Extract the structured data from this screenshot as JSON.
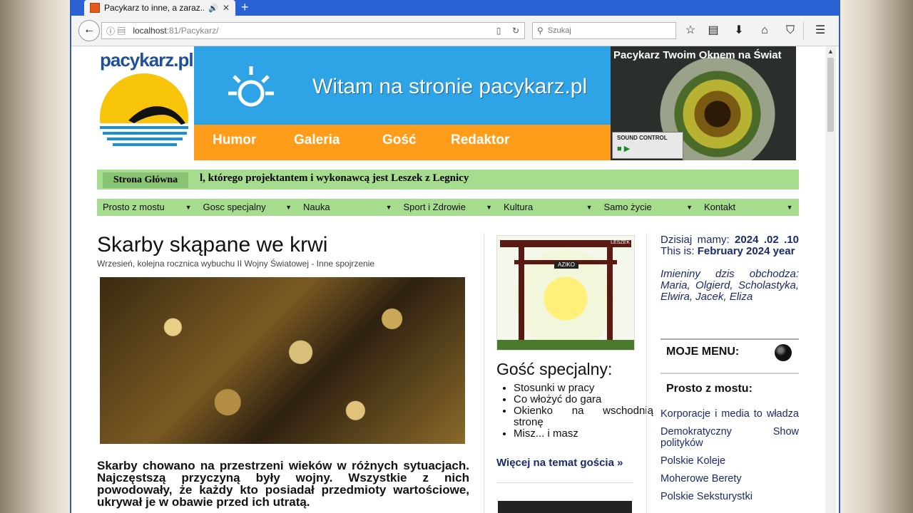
{
  "browser": {
    "tab_title": "Pacykarz to inne, a zaraz...",
    "url_prefix": "localhost",
    "url_rest": ":81/Pacykarz/",
    "search_placeholder": "Szukaj"
  },
  "site": {
    "logo": "pacykarz.pl",
    "banner_title": "Witam na stronie pacykarz.pl",
    "banner_nav": [
      "Humor",
      "Galeria",
      "Gość",
      "Redaktor"
    ],
    "eye_title": "Pacykarz Twoim Oknem na Świat",
    "sound_control": "SOUND CONTROL",
    "home_label": "Strona Główna",
    "ticker": "l, którego projektantem i wykonawcą jest Leszek z Legnicy",
    "menu": [
      "Prosto z mostu",
      "Gosc specjalny",
      "Nauka",
      "Sport i Zdrowie",
      "Kultura",
      "Samo życie",
      "Kontakt"
    ]
  },
  "article": {
    "title": "Skarby skąpane we krwi",
    "subtitle": "Wrzesień, kolejna rocznica wybuchu II Wojny Światowej - Inne spojrzenie",
    "body": "Skarby chowano na przestrzeni wieków w różnych sytuacjach. Najczęstszą przyczyną były wojny. Wszystkie z nich powodowały, że każdy kto posiadał przedmioty wartościowe, ukrywał je w obawie przed ich utratą."
  },
  "guest": {
    "image_sign": "AZIKO",
    "image_corner": "LESZEK",
    "title": "Gość specjalny:",
    "items": [
      "Stosunki w pracy",
      "Co włożyć do gara",
      "Okienko na wschodnią stronę",
      "Misz... i masz"
    ],
    "more": "Więcej na temat gościa »"
  },
  "sidebar": {
    "date_prefix": "Dzisiaj mamy:",
    "date_value": "2024 .02 .10",
    "this_is": "This is:",
    "this_value": "February 2024 year",
    "names": "Imieniny dzis obchodza: Maria, Olgierd, Scholastyka, Elwira, Jacek, Eliza",
    "my_menu": "MOJE MENU:",
    "section_title": "Prosto z mostu:",
    "links": [
      "Korporacje i media to władza",
      "Demokratyczny Show polityków",
      "Polskie Koleje",
      "Moherowe Berety",
      "Polskie Seksturystki"
    ]
  },
  "colors": {
    "menu_green": "#a6dc8e",
    "banner_blue": "#2ea3e6",
    "banner_orange": "#ff9d1a",
    "link_navy": "#1b2a6b"
  }
}
